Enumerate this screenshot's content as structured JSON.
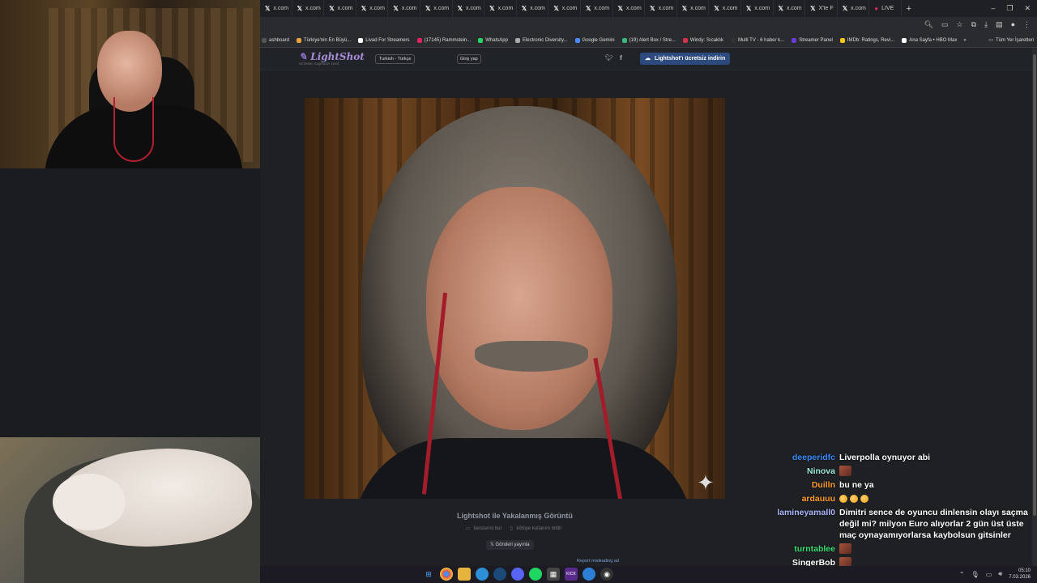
{
  "tabs": [
    {
      "label": "x.com"
    },
    {
      "label": "x.com"
    },
    {
      "label": "x.com"
    },
    {
      "label": "x.com"
    },
    {
      "label": "x.com"
    },
    {
      "label": "x.com"
    },
    {
      "label": "x.com"
    },
    {
      "label": "x.com"
    },
    {
      "label": "x.com"
    },
    {
      "label": "x.com"
    },
    {
      "label": "x.com"
    },
    {
      "label": "x.com"
    },
    {
      "label": "x.com"
    },
    {
      "label": "x.com"
    },
    {
      "label": "x.com"
    },
    {
      "label": "x.com"
    },
    {
      "label": "x.com"
    },
    {
      "label": "X'te F"
    },
    {
      "label": "x.com"
    },
    {
      "label": "LIVE"
    }
  ],
  "bookmarks": [
    {
      "label": "ashboard",
      "color": "#555"
    },
    {
      "label": "Türkiye'nin En Büyü...",
      "color": "#e6a23c"
    },
    {
      "label": "Livad For Streamers",
      "color": "#ffffff"
    },
    {
      "label": "(17145) Rammstein...",
      "color": "#e0245e"
    },
    {
      "label": "WhatsApp",
      "color": "#25d366"
    },
    {
      "label": "Electronic Diversity...",
      "color": "#aaaaaa"
    },
    {
      "label": "Google Gemini",
      "color": "#4a8cff"
    },
    {
      "label": "(19) Alert Box / Stre...",
      "color": "#3ab77a"
    },
    {
      "label": "Windy: Sıcaklık",
      "color": "#d0334b"
    },
    {
      "label": "Multi TV - 6 haber k...",
      "color": "#333333"
    },
    {
      "label": "Streamer Panel",
      "color": "#6a3bd6"
    },
    {
      "label": "IMDb: Ratings, Revi...",
      "color": "#f5c518"
    },
    {
      "label": "Ana Sayfa • HBO Max",
      "color": "#ffffff"
    }
  ],
  "bookmarks_more": "»",
  "all_bookmarks": "Tüm Yer İşaretleri",
  "lightshot": {
    "logo": "LightShot",
    "tagline": "screen capture tool",
    "lang": "Turkish - Türkçe",
    "login": "Giriş yap",
    "download": "Lightshot'ı ücretsiz indirin",
    "caption": "Lightshot ile Yakalanmış Görüntü",
    "similar": "benzerini bul",
    "report_abuse": "kötüye kullanım bildir",
    "tweet": "Gönderi yayınla",
    "report_ad": "Report misleading ad"
  },
  "chat": [
    {
      "user": "deeperidfc",
      "color": "#3b8bff",
      "text": "Liverpolla oynuyor abi"
    },
    {
      "user": "Ninova",
      "color": "#9fe8d8",
      "text": "",
      "emote": true
    },
    {
      "user": "Duilln",
      "color": "#ff9e2c",
      "text": "bu ne ya"
    },
    {
      "user": "ardauuu",
      "color": "#ff9e2c",
      "text": "",
      "emojis": 3
    },
    {
      "user": "lamineyamall0",
      "color": "#aeb8ff",
      "text": "Dimitri sence de oyuncu dinlensin olayı saçma değil mi? milyon Euro alıyorlar 2 gün üst üste maç oynayamıyorlarsa kaybolsun gitsinler"
    },
    {
      "user": "turntablee",
      "color": "#3bdc74",
      "text": "",
      "emote": true
    },
    {
      "user": "SingerBob",
      "color": "#ffffff",
      "text": "",
      "emote": true
    }
  ],
  "clock": {
    "time": "05:10",
    "date": "7.03.2026"
  }
}
